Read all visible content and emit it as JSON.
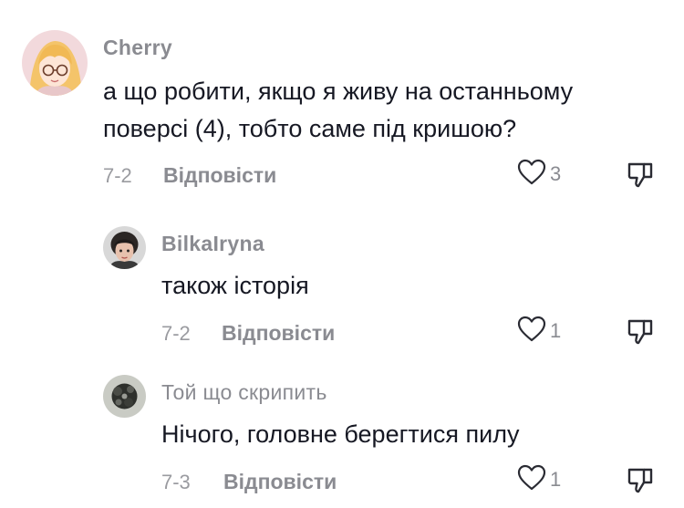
{
  "comments": [
    {
      "username": "Cherry",
      "text_lines": [
        "а що робити, якщо я живу на останньому",
        "поверсі (4), тобто саме під кришою?"
      ],
      "date": "7-2",
      "reply_label": "Відповісти",
      "likes": "3"
    },
    {
      "username": "BilkaIryna",
      "text_lines": [
        "також історія"
      ],
      "date": "7-2",
      "reply_label": "Відповісти",
      "likes": "1"
    },
    {
      "username": "Той що скрипить",
      "text_lines": [
        "Нічого, головне берегтися пилу"
      ],
      "date": "7-3",
      "reply_label": "Відповісти",
      "likes": "1"
    }
  ],
  "icons": {
    "like": "heart-outline-icon",
    "dislike": "thumbs-down-icon"
  },
  "colors": {
    "primary_text": "#161823",
    "secondary_text": "#8a8b91",
    "icon_stroke": "#2a2b33"
  }
}
